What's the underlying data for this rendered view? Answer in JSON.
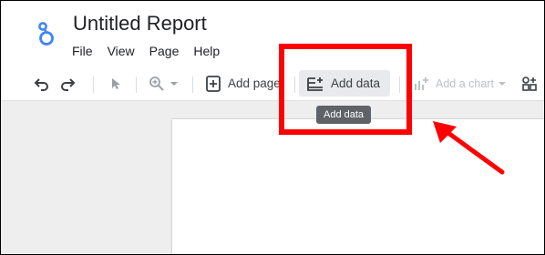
{
  "app": {
    "title": "Untitled Report",
    "menu": [
      "File",
      "View",
      "Page",
      "Help"
    ]
  },
  "toolbar": {
    "undo_icon": "undo-icon",
    "redo_icon": "redo-icon",
    "select_icon": "cursor-icon",
    "zoom_icon": "zoom-icon",
    "add_page_label": "Add page",
    "add_data_label": "Add data",
    "add_chart_label": "Add a chart"
  },
  "tooltip": {
    "text": "Add data"
  },
  "annotation": {
    "color": "#ff0000"
  }
}
